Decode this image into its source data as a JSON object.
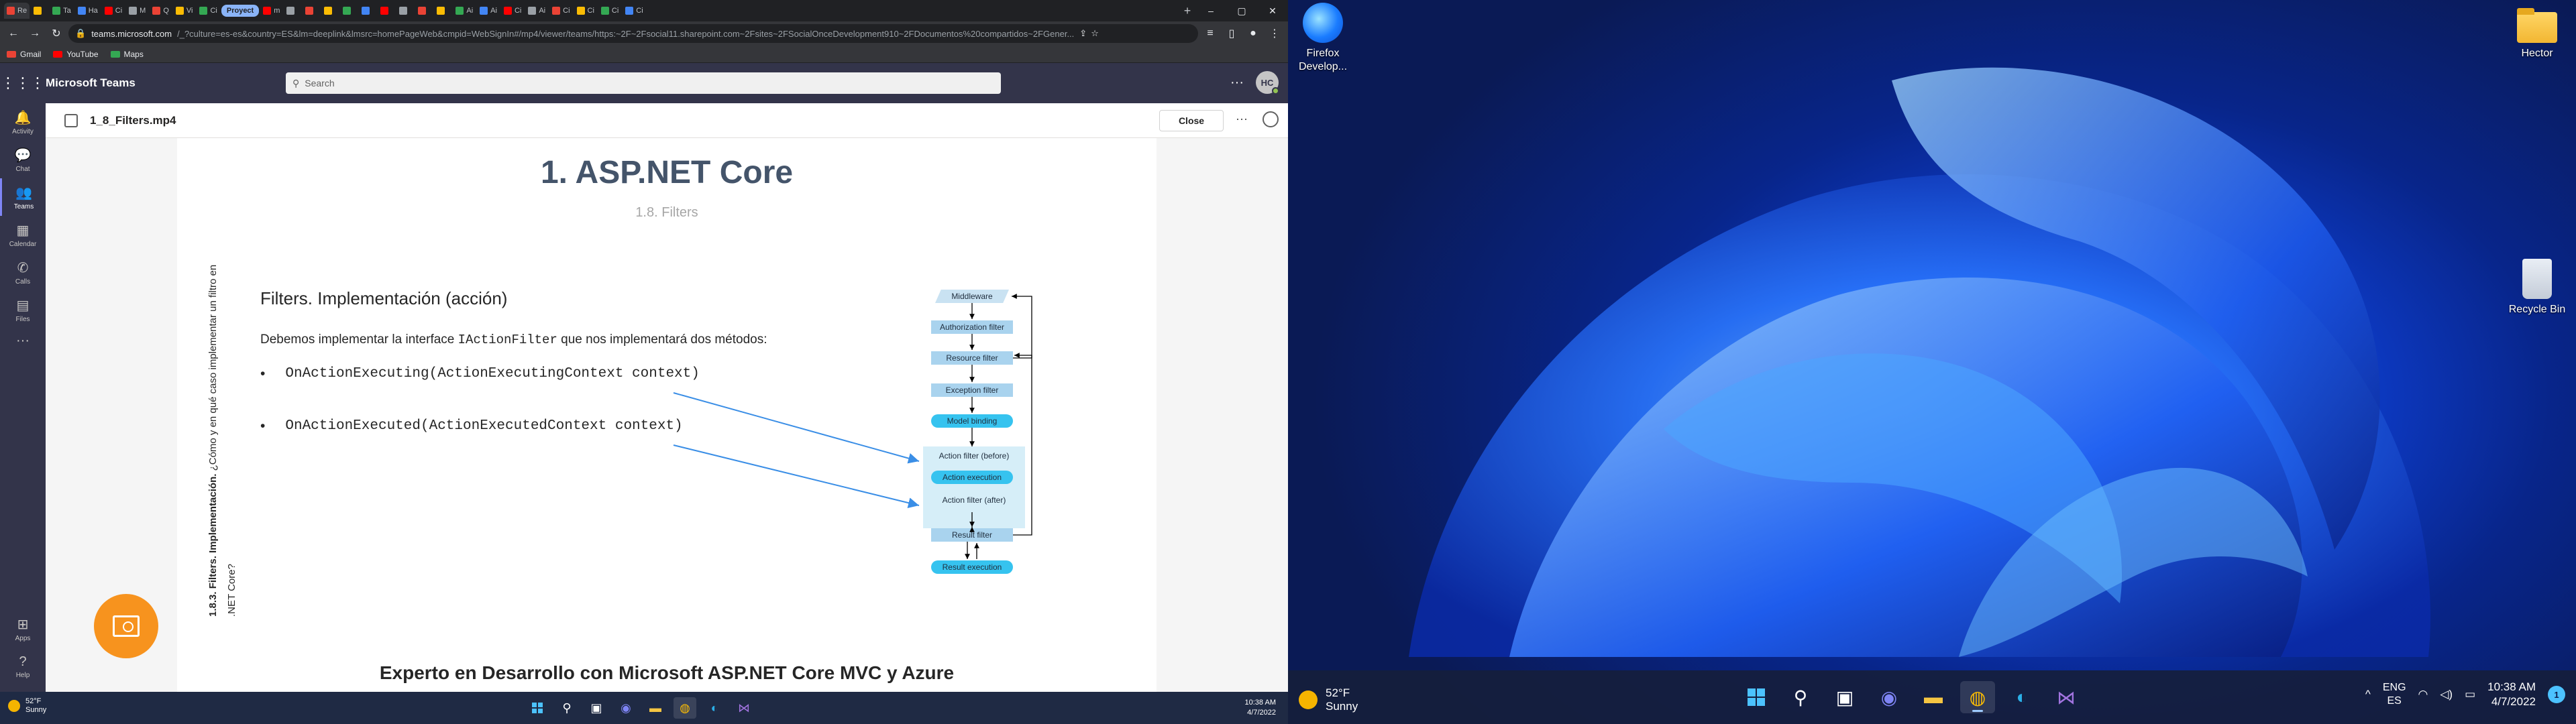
{
  "browser": {
    "tabs": [
      "Re",
      "",
      "Ta",
      "Ha",
      "Ci",
      "M",
      "Q",
      "Vi",
      "Ci",
      "Proyect",
      "m",
      "",
      "",
      "",
      "",
      "",
      "",
      "",
      "",
      "",
      "Ai",
      "Ai",
      "Ci",
      "Ai",
      "Ci",
      "Ci",
      "Ci",
      "Ci"
    ],
    "group_label": "Proyect",
    "new_tab": "+",
    "controls": {
      "min": "–",
      "max": "▢",
      "close": "✕"
    },
    "url_host": "teams.microsoft.com",
    "url_path": "/_?culture=es-es&country=ES&lm=deeplink&lmsrc=homePageWeb&cmpid=WebSignIn#/mp4/viewer/teams/https:~2F~2Fsocial11.sharepoint.com~2Fsites~2FSocialOnceDevelopment910~2FDocumentos%20compartidos~2FGener...",
    "bookmarks": [
      {
        "label": "Gmail",
        "color": "#ea4335"
      },
      {
        "label": "YouTube",
        "color": "#ff0000"
      },
      {
        "label": "Maps",
        "color": "#34a853"
      }
    ]
  },
  "teams": {
    "app_name": "Microsoft Teams",
    "search_placeholder": "Search",
    "avatar_initials": "HC",
    "rail": [
      {
        "label": "Activity",
        "icon": "bell-icon"
      },
      {
        "label": "Chat",
        "icon": "chat-icon"
      },
      {
        "label": "Teams",
        "icon": "teams-icon",
        "active": true
      },
      {
        "label": "Calendar",
        "icon": "calendar-icon"
      },
      {
        "label": "Calls",
        "icon": "phone-icon"
      },
      {
        "label": "Files",
        "icon": "file-icon"
      }
    ],
    "rail_more": "···",
    "rail_bottom": [
      {
        "label": "Apps"
      },
      {
        "label": "Help"
      }
    ],
    "file_name": "1_8_Filters.mp4",
    "close_label": "Close",
    "more_label": "···"
  },
  "slide": {
    "title": "1. ASP.NET Core",
    "subtitle": "1.8. Filters",
    "side_bold": "1.8.3. Filters. Implementación.",
    "side_text": " ¿Cómo y en qué caso implementar un filtro en .NET Core?",
    "heading": "Filters. Implementación (acción)",
    "intro_pre": "Debemos implementar la interface ",
    "intro_code": "IActionFilter",
    "intro_post": " que nos implementará dos métodos:",
    "bullets": [
      "OnActionExecuting(ActionExecutingContext context)",
      "OnActionExecuted(ActionExecutedContext context)"
    ],
    "bullet_char": "•",
    "footer": "Experto en Desarrollo con Microsoft ASP.NET Core MVC y Azure",
    "pipeline": {
      "middleware": "Middleware",
      "authorization": "Authorization filter",
      "resource": "Resource filter",
      "exception": "Exception filter",
      "model_binding": "Model binding",
      "action_before": "Action filter (before)",
      "action_execution": "Action execution",
      "action_after": "Action filter (after)",
      "result_filter": "Result filter",
      "result_execution": "Result execution"
    }
  },
  "left_taskbar": {
    "temp": "52°F",
    "condition": "Sunny",
    "time": "10:38 AM",
    "date": "4/7/2022"
  },
  "desktop": {
    "icons": [
      {
        "label": "Firefox Develop..."
      },
      {
        "label": "Hector"
      },
      {
        "label": "Recycle Bin"
      }
    ]
  },
  "right_taskbar": {
    "temp": "52°F",
    "condition": "Sunny",
    "lang1": "ENG",
    "lang2": "ES",
    "time": "10:38 AM",
    "date": "4/7/2022",
    "notifications": "1"
  }
}
